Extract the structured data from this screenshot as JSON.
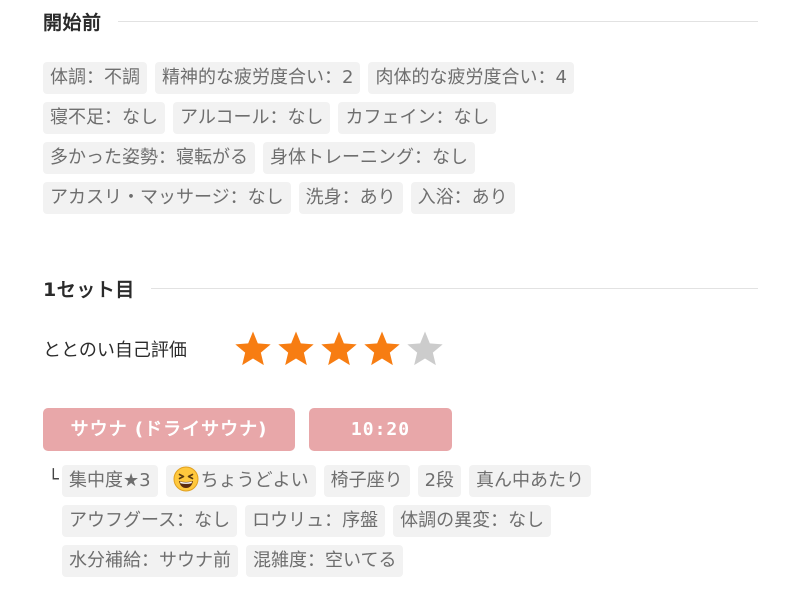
{
  "before": {
    "title": "開始前",
    "rows": [
      [
        "体調：不調",
        "精神的な疲労度合い：2",
        "肉体的な疲労度合い：4"
      ],
      [
        "寝不足：なし",
        "アルコール：なし",
        "カフェイン：なし"
      ],
      [
        "多かった姿勢：寝転がる",
        "身体トレーニング：なし"
      ],
      [
        "アカスリ・マッサージ：なし",
        "洗身：あり",
        "入浴：あり"
      ]
    ]
  },
  "set1": {
    "title": "1セット目",
    "rating": {
      "label": "ととのい自己評価",
      "value": 4,
      "max": 5,
      "filled_color": "#f77d12",
      "empty_color": "#cccccc"
    },
    "sauna_type": "サウナ (ドライサウナ)",
    "duration": "10:20",
    "branch_mark": "└",
    "details": {
      "concentration": "集中度★3",
      "mood_icon": "grinning-squinting-face-icon",
      "mood": "ちょうどよい",
      "seat": "椅子座り",
      "tier": "2段",
      "position": "真ん中あたり",
      "aufguss": "アウフグース：なし",
      "loyly": "ロウリュ：序盤",
      "abnormality": "体調の異変：なし",
      "hydration": "水分補給：サウナ前",
      "crowd": "混雑度：空いてる"
    }
  },
  "colors": {
    "badge": "#e8a7a9",
    "chip_bg": "#f2f2f2",
    "chip_text": "#6e6e6e",
    "divider": "#e2e2e2"
  }
}
